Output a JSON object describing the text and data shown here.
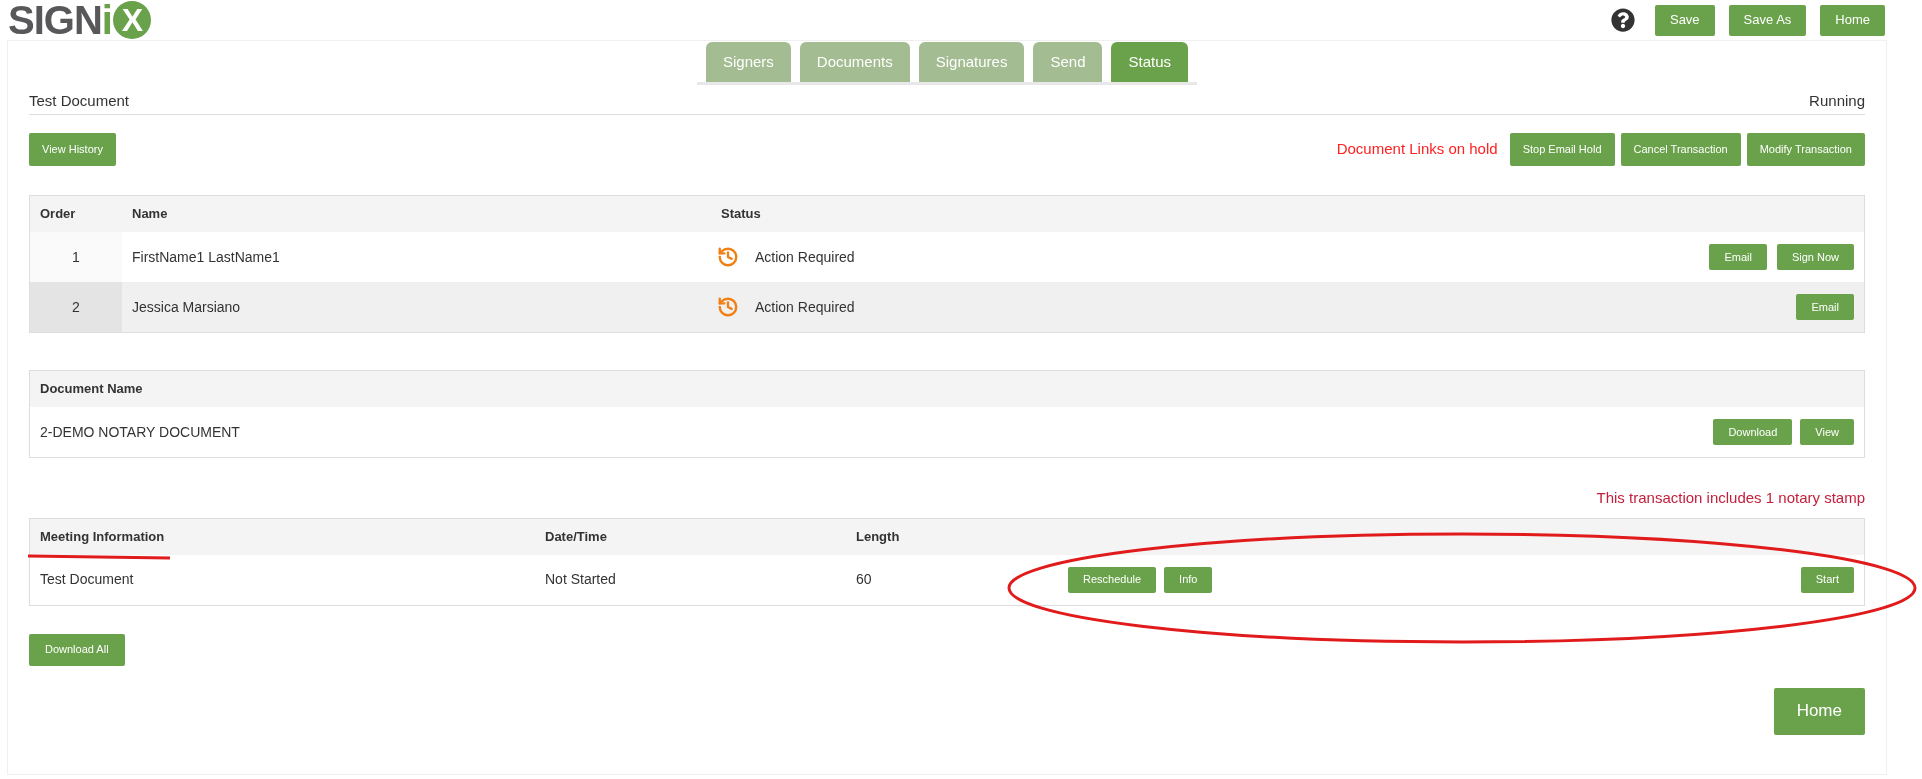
{
  "logo": {
    "text": "SIGN",
    "accent": "i",
    "badge": "X"
  },
  "header_buttons": [
    "Save",
    "Save As",
    "Home"
  ],
  "tabs": [
    {
      "label": "Signers",
      "selected": false
    },
    {
      "label": "Documents",
      "selected": false
    },
    {
      "label": "Signatures",
      "selected": false
    },
    {
      "label": "Send",
      "selected": false
    },
    {
      "label": "Status",
      "selected": true
    }
  ],
  "document": {
    "title": "Test Document",
    "state": "Running"
  },
  "actions": {
    "left": [
      "View History"
    ],
    "notice": "Document Links on hold",
    "right": [
      "Stop Email Hold",
      "Cancel Transaction",
      "Modify Transaction"
    ]
  },
  "signers_table": {
    "columns": [
      "Order",
      "Name",
      "Status"
    ],
    "rows": [
      {
        "order": "1",
        "name": "FirstName1 LastName1",
        "status": "Action Required",
        "buttons": [
          "Email",
          "Sign Now"
        ]
      },
      {
        "order": "2",
        "name": "Jessica Marsiano",
        "status": "Action Required",
        "buttons": [
          "Email"
        ]
      }
    ]
  },
  "documents_table": {
    "columns": [
      "Document Name"
    ],
    "rows": [
      {
        "name": "2-DEMO NOTARY DOCUMENT",
        "buttons": [
          "Download",
          "View"
        ]
      }
    ]
  },
  "notary_notice": "This transaction includes 1 notary stamp",
  "meeting_table": {
    "columns": [
      {
        "label": "Meeting Information",
        "underlined": true
      },
      {
        "label": "Date/Time",
        "underlined": false
      },
      {
        "label": "Length",
        "underlined": false
      }
    ],
    "rows": [
      {
        "meeting": "Test Document",
        "date_time": "Not Started",
        "length": "60",
        "buttons": [
          "Reschedule",
          "Info"
        ],
        "end_buttons": [
          "Start"
        ],
        "circled": true
      }
    ]
  },
  "footer_buttons": [
    "Download All"
  ],
  "bottom_button": "Home"
}
